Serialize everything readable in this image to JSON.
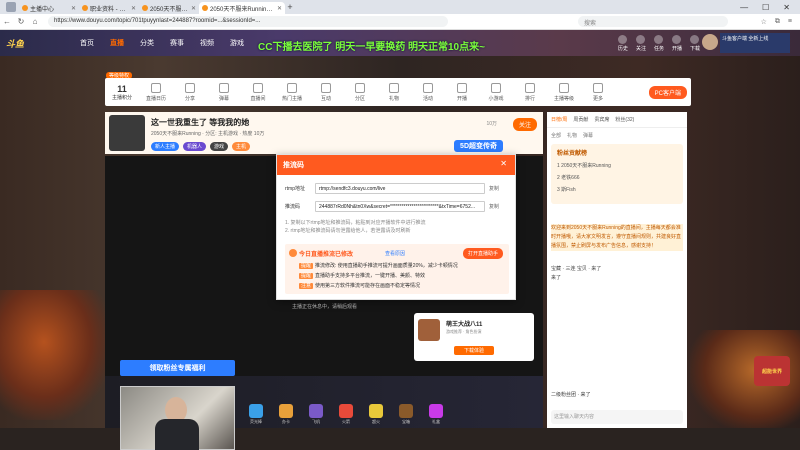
{
  "browser": {
    "tabs": [
      {
        "label": "主播中心",
        "active": false
      },
      {
        "label": "职业资料 - 个人中心 - 斗鱼",
        "active": false
      },
      {
        "label": "2050天不服来Running - 斗鱼直播",
        "active": false
      },
      {
        "label": "2050天不服来Running - 斗鱼直播",
        "active": true
      }
    ],
    "url": "https://www.douyu.com/topic/701tpuyynlast=244887?roomid=...&sessionId=...",
    "search_placeholder": "搜索",
    "icons": [
      "back-icon",
      "refresh-icon",
      "home-icon",
      "star-icon",
      "extensions-icon",
      "menu-icon"
    ]
  },
  "site": {
    "logo": "斗鱼",
    "nav": [
      "首页",
      "直播",
      "分类",
      "赛事",
      "视频",
      "游戏"
    ],
    "nav_active": "直播",
    "marquee": "CC下播去医院了 明天一早要换药 明天正常10点来~",
    "header_icons": [
      "历史",
      "关注",
      "任务",
      "开播",
      "下载"
    ],
    "promo": "斗鱼客户端 全新上线"
  },
  "toolbar": {
    "badge": "等级特权",
    "first": {
      "num": "11",
      "label": "主播积分"
    },
    "items": [
      "直播日历",
      "分享",
      "弹幕",
      "直播间",
      "热门主播",
      "互动",
      "分区",
      "礼物",
      "活动",
      "开播",
      "小游戏",
      "排行",
      "主播等级",
      "更多"
    ],
    "pc_button": "PC客户端"
  },
  "anchor": {
    "title": "这一世我重生了 等我我的她",
    "meta": "2050天不服来Running · 分区: 主机游戏 · 热度 10万",
    "tags": [
      "新人主播",
      "机器人",
      "游戏",
      "主机"
    ],
    "watch": "10万",
    "follow_label": "关注",
    "banner": "5D超变传奇"
  },
  "modal": {
    "title": "推流码",
    "rtmp_label": "rtmp地址",
    "rtmp_value": "rtmp://sendfc3.douyu.com/live",
    "key_label": "推流码",
    "key_value": "244887rRd0Nh&tn0Xw&secret=*************************&txTime=6752...",
    "copy_label": "复制",
    "notes": [
      "1. 复制以下rtmp地址和推流码，粘贴到对应开播软件中进行推流",
      "2. rtmp地址和推流码请勿泄露给他人，若泄露请及时刷新"
    ],
    "warn_title": "今日直播推流已修改",
    "warn_link": "查看原因",
    "warn_button": "打开直播助手",
    "warn_lines": [
      {
        "tag": "提醒",
        "text": "推流修改: 使用直播助手推流可提升画面质量20%，减少卡顿情况"
      },
      {
        "tag": "提醒",
        "text": "直播助手支持多平台推流，一键开播、美颜、特效"
      },
      {
        "tag": "注意",
        "text": "使用第三方软件推流可能存在画面不稳定等情况"
      }
    ]
  },
  "video": {
    "hint": "主播正在休息中，请稍后观看",
    "game_card": {
      "title": "萌王大战八11",
      "sub": "游戏推荐 · 角色扮演",
      "button": "下载体验"
    }
  },
  "gifts": [
    "荧光棒",
    "办卡",
    "飞机",
    "火箭",
    "超火",
    "宝箱",
    "礼盒"
  ],
  "fan_button": "领取粉丝专属福利",
  "chat": {
    "tabs": [
      "日榜/周",
      "周贡献",
      "贵宾席",
      "粉丝(32)"
    ],
    "sub": [
      "全部",
      "礼物",
      "弹幕"
    ],
    "fan_zone_title": "粉丝贡献榜",
    "fan_rows": [
      "1  2050天不服来Running",
      "2  老铁666",
      "3  斯Fish"
    ],
    "messages": [
      "欢迎来到2050天不服来Running的直播间，主播每天都会准时开播哦，请大家文明发言，遵守直播间规则，共建良好直播氛围，禁止刷屏与发布广告信息，感谢支持！",
      "宝藏 · 三连  宝贝 · 来了",
      "来了"
    ],
    "last_msg": "二级粉丝团 · 来了",
    "input_placeholder": "这里输入聊天内容"
  },
  "right_deco": "超能世界"
}
